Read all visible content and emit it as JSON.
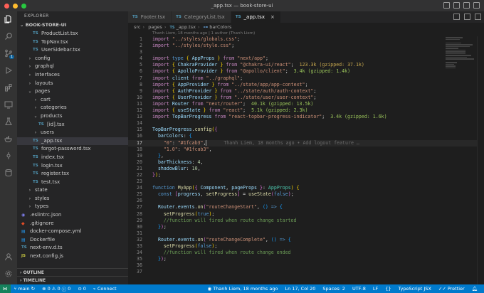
{
  "window": {
    "title": "_app.tsx — book-store-ui",
    "colors": {
      "close": "#ff5f57",
      "minimize": "#febc2e",
      "maximize": "#28c840",
      "accent": "#007acc"
    }
  },
  "activity_bar": {
    "icons": [
      "files-icon",
      "search-icon",
      "source-control-icon",
      "run-debug-icon",
      "extensions-icon",
      "remote-explorer-icon",
      "testing-icon",
      "docker-icon",
      "gitlens-icon",
      "database-icon",
      "account-icon",
      "settings-gear-icon"
    ],
    "source_control_badge": "1"
  },
  "sidebar": {
    "header": "EXPLORER",
    "root": "BOOK-STORE-UI",
    "items": [
      {
        "depth": 2,
        "kind": "ts",
        "label": "ProductList.tsx"
      },
      {
        "depth": 2,
        "kind": "ts",
        "label": "TopNav.tsx"
      },
      {
        "depth": 2,
        "kind": "ts",
        "label": "UserSidebar.tsx"
      },
      {
        "depth": 1,
        "kind": "folder",
        "label": "config"
      },
      {
        "depth": 1,
        "kind": "folder",
        "label": "graphql"
      },
      {
        "depth": 1,
        "kind": "folder",
        "label": "interfaces"
      },
      {
        "depth": 1,
        "kind": "folder",
        "label": "layouts"
      },
      {
        "depth": 1,
        "kind": "folder-open",
        "label": "pages"
      },
      {
        "depth": 2,
        "kind": "folder",
        "label": "cart"
      },
      {
        "depth": 2,
        "kind": "folder",
        "label": "categories"
      },
      {
        "depth": 2,
        "kind": "folder-open",
        "label": "products"
      },
      {
        "depth": 3,
        "kind": "ts",
        "label": "[id].tsx"
      },
      {
        "depth": 2,
        "kind": "folder",
        "label": "users"
      },
      {
        "depth": 2,
        "kind": "ts",
        "label": "_app.tsx",
        "active": true
      },
      {
        "depth": 2,
        "kind": "ts",
        "label": "forgot-password.tsx"
      },
      {
        "depth": 2,
        "kind": "ts",
        "label": "index.tsx"
      },
      {
        "depth": 2,
        "kind": "ts",
        "label": "login.tsx"
      },
      {
        "depth": 2,
        "kind": "ts",
        "label": "register.tsx"
      },
      {
        "depth": 2,
        "kind": "ts",
        "label": "test.tsx"
      },
      {
        "depth": 1,
        "kind": "folder",
        "label": "state"
      },
      {
        "depth": 1,
        "kind": "folder",
        "label": "styles"
      },
      {
        "depth": 1,
        "kind": "folder",
        "label": "types"
      },
      {
        "depth": 0,
        "kind": "eslint",
        "label": ".eslintrc.json"
      },
      {
        "depth": 0,
        "kind": "git",
        "label": ".gitignore"
      },
      {
        "depth": 0,
        "kind": "docker",
        "label": "docker-compose.yml"
      },
      {
        "depth": 0,
        "kind": "docker",
        "label": "Dockerfile"
      },
      {
        "depth": 0,
        "kind": "ts",
        "label": "next-env.d.ts"
      },
      {
        "depth": 0,
        "kind": "js",
        "label": "next.config.js"
      }
    ],
    "sections": [
      "OUTLINE",
      "TIMELINE"
    ]
  },
  "tabs": [
    {
      "label": "Footer.tsx",
      "active": false
    },
    {
      "label": "CategoryList.tsx",
      "active": false
    },
    {
      "label": "_app.tsx",
      "active": true
    }
  ],
  "breadcrumbs": [
    "src",
    "pages",
    "_app.tsx",
    "barColors"
  ],
  "blame_header": "Thanh Liem, 18 months ago | 1 author (Thanh Liem)",
  "editor": {
    "inline_blame": "Thanh Liem, 18 months ago • Add logout feature …",
    "lines": [
      {
        "n": "1",
        "html": "<span class=\"k\">import</span> <span class=\"s\">\"../styles/globals.css\"</span><span class=\"p\">;</span>"
      },
      {
        "n": "2",
        "html": "<span class=\"k\">import</span> <span class=\"s\">\"../styles/style.css\"</span><span class=\"p\">;</span>"
      },
      {
        "n": "3",
        "html": ""
      },
      {
        "n": "4",
        "html": "<span class=\"k\">import</span> <span class=\"k2\">type</span> <span class=\"y\">{</span> <span class=\"v\">AppProps</span> <span class=\"y\">}</span> <span class=\"k\">from</span> <span class=\"s\">\"next/app\"</span><span class=\"p\">;</span>"
      },
      {
        "n": "5",
        "html": "<span class=\"k\">import</span> <span class=\"y\">{</span> <span class=\"v\">ChakraProvider</span> <span class=\"y\">}</span> <span class=\"k\">from</span> <span class=\"s\">\"@chakra-ui/react\"</span><span class=\"p\">;</span>  <span class=\"sizew\">123.3k (gzipped: 37.1k)</span>"
      },
      {
        "n": "6",
        "html": "<span class=\"k\">import</span> <span class=\"y\">{</span> <span class=\"v\">ApolloProvider</span> <span class=\"y\">}</span> <span class=\"k\">from</span> <span class=\"s\">\"@apollo/client\"</span><span class=\"p\">;</span>  <span class=\"size\">3.4k (gzipped: 1.4k)</span>"
      },
      {
        "n": "7",
        "html": "<span class=\"k\">import</span> <span class=\"v\">client</span> <span class=\"k\">from</span> <span class=\"s\">\"../graphql\"</span><span class=\"p\">;</span>"
      },
      {
        "n": "8",
        "html": "<span class=\"k\">import</span> <span class=\"y\">{</span> <span class=\"v\">AppProvider</span> <span class=\"y\">}</span> <span class=\"k\">from</span> <span class=\"s\">\"../state/app/app-context\"</span><span class=\"p\">;</span>"
      },
      {
        "n": "9",
        "html": "<span class=\"k\">import</span> <span class=\"y\">{</span> <span class=\"v\">AuthProvider</span> <span class=\"y\">}</span> <span class=\"k\">from</span> <span class=\"s\">\"../state/auth/auth-context\"</span><span class=\"p\">;</span>"
      },
      {
        "n": "10",
        "html": "<span class=\"k\">import</span> <span class=\"y\">{</span> <span class=\"v\">UserProvider</span> <span class=\"y\">}</span> <span class=\"k\">from</span> <span class=\"s\">\"../state/user/user-context\"</span><span class=\"p\">;</span>"
      },
      {
        "n": "11",
        "html": "<span class=\"k\">import</span> <span class=\"v\">Router</span> <span class=\"k\">from</span> <span class=\"s\">\"next/router\"</span><span class=\"p\">;</span>  <span class=\"size\">40.1k (gzipped: 13.5k)</span>"
      },
      {
        "n": "12",
        "html": "<span class=\"k\">import</span> <span class=\"y\">{</span> <span class=\"v\">useState</span> <span class=\"y\">}</span> <span class=\"k\">from</span> <span class=\"s\">\"react\"</span><span class=\"p\">;</span>  <span class=\"size\">5.1k (gzipped: 2.3k)</span>"
      },
      {
        "n": "13",
        "html": "<span class=\"k\">import</span> <span class=\"v\">TopBarProgress</span> <span class=\"k\">from</span> <span class=\"s\">\"react-topbar-progress-indicator\"</span><span class=\"p\">;</span>  <span class=\"size\">3.4k (gzipped: 1.6k)</span>"
      },
      {
        "n": "14",
        "html": ""
      },
      {
        "n": "15",
        "html": "<span class=\"v\">TopBarProgress</span><span class=\"p\">.</span><span class=\"f\">config</span><span class=\"y\">(</span><span class=\"pk\">{</span>"
      },
      {
        "n": "16",
        "html": "  <span class=\"v\">barColors</span><span class=\"p\">: </span><span class=\"bl\">{</span>"
      },
      {
        "n": "17",
        "html": "    <span class=\"s\">\"0\"</span><span class=\"p\">: </span><span class=\"s\">\"#1fcab3\"</span><span class=\"p\">,</span><span class=\"cursor\"></span>      <span class=\"hint\" data-ref=\"inline_blame\"></span>",
        "current": true
      },
      {
        "n": "18",
        "html": "    <span class=\"s\">\"1.0\"</span><span class=\"p\">: </span><span class=\"s\">\"#1fcab3\"</span><span class=\"p\">,</span>"
      },
      {
        "n": "19",
        "html": "  <span class=\"bl\">}</span><span class=\"p\">,</span>"
      },
      {
        "n": "20",
        "html": "  <span class=\"v\">barThickness</span><span class=\"p\">: </span><span class=\"n\">4</span><span class=\"p\">,</span>"
      },
      {
        "n": "21",
        "html": "  <span class=\"v\">shadowBlur</span><span class=\"p\">: </span><span class=\"n\">10</span><span class=\"p\">,</span>"
      },
      {
        "n": "22",
        "html": "<span class=\"pk\">}</span><span class=\"y\">)</span><span class=\"p\">;</span>"
      },
      {
        "n": "23",
        "html": ""
      },
      {
        "n": "24",
        "html": "<span class=\"k2\">function</span> <span class=\"f\">MyApp</span><span class=\"y\">(</span><span class=\"pk\">{</span> <span class=\"v\">Component</span><span class=\"p\">, </span><span class=\"v\">pageProps</span> <span class=\"pk\">}</span><span class=\"p\">: </span><span class=\"t\">AppProps</span><span class=\"y\">)</span> <span class=\"y\">{</span>"
      },
      {
        "n": "25",
        "html": "  <span class=\"k2\">const</span> <span class=\"pk\">[</span><span class=\"v\">progress</span><span class=\"p\">, </span><span class=\"f\">setProgress</span><span class=\"pk\">]</span> <span class=\"p\">=</span> <span class=\"f\">useState</span><span class=\"pk\">(</span><span class=\"k2\">false</span><span class=\"pk\">)</span><span class=\"p\">;</span>"
      },
      {
        "n": "26",
        "html": ""
      },
      {
        "n": "27",
        "html": "  <span class=\"v\">Router</span><span class=\"p\">.</span><span class=\"v\">events</span><span class=\"p\">.</span><span class=\"f\">on</span><span class=\"pk\">(</span><span class=\"s\">\"routeChangeStart\"</span><span class=\"p\">, </span><span class=\"bl\">()</span> <span class=\"k2\">=&gt;</span> <span class=\"bl\">{</span>"
      },
      {
        "n": "28",
        "html": "    <span class=\"f\">setProgress</span><span class=\"y\">(</span><span class=\"k2\">true</span><span class=\"y\">)</span><span class=\"p\">;</span>"
      },
      {
        "n": "29",
        "html": "    <span class=\"c\">//function will fired when route change started</span>"
      },
      {
        "n": "30",
        "html": "  <span class=\"bl\">}</span><span class=\"pk\">)</span><span class=\"p\">;</span>"
      },
      {
        "n": "31",
        "html": ""
      },
      {
        "n": "32",
        "html": "  <span class=\"v\">Router</span><span class=\"p\">.</span><span class=\"v\">events</span><span class=\"p\">.</span><span class=\"f\">on</span><span class=\"pk\">(</span><span class=\"s\">\"routeChangeComplete\"</span><span class=\"p\">, </span><span class=\"bl\">()</span> <span class=\"k2\">=&gt;</span> <span class=\"bl\">{</span>"
      },
      {
        "n": "33",
        "html": "    <span class=\"f\">setProgress</span><span class=\"y\">(</span><span class=\"k2\">false</span><span class=\"y\">)</span><span class=\"p\">;</span>"
      },
      {
        "n": "34",
        "html": "    <span class=\"c\">//function will fired when route change ended</span>"
      },
      {
        "n": "35",
        "html": "  <span class=\"bl\">}</span><span class=\"pk\">)</span><span class=\"p\">;</span>"
      },
      {
        "n": "36",
        "html": ""
      },
      {
        "n": "37",
        "html": ""
      }
    ]
  },
  "status_bar": {
    "branch": "main",
    "sync": "↻",
    "errors": "0",
    "warnings": "0",
    "info": "0",
    "ports": "0",
    "connect": "Connect",
    "author": "Thanh Liem, 18 months ago",
    "position": "Ln 17, Col 20",
    "spaces": "Spaces: 2",
    "encoding": "UTF-8",
    "eol": "LF",
    "braces": "{}",
    "language": "TypeScript JSX",
    "formatter": "Prettier"
  }
}
